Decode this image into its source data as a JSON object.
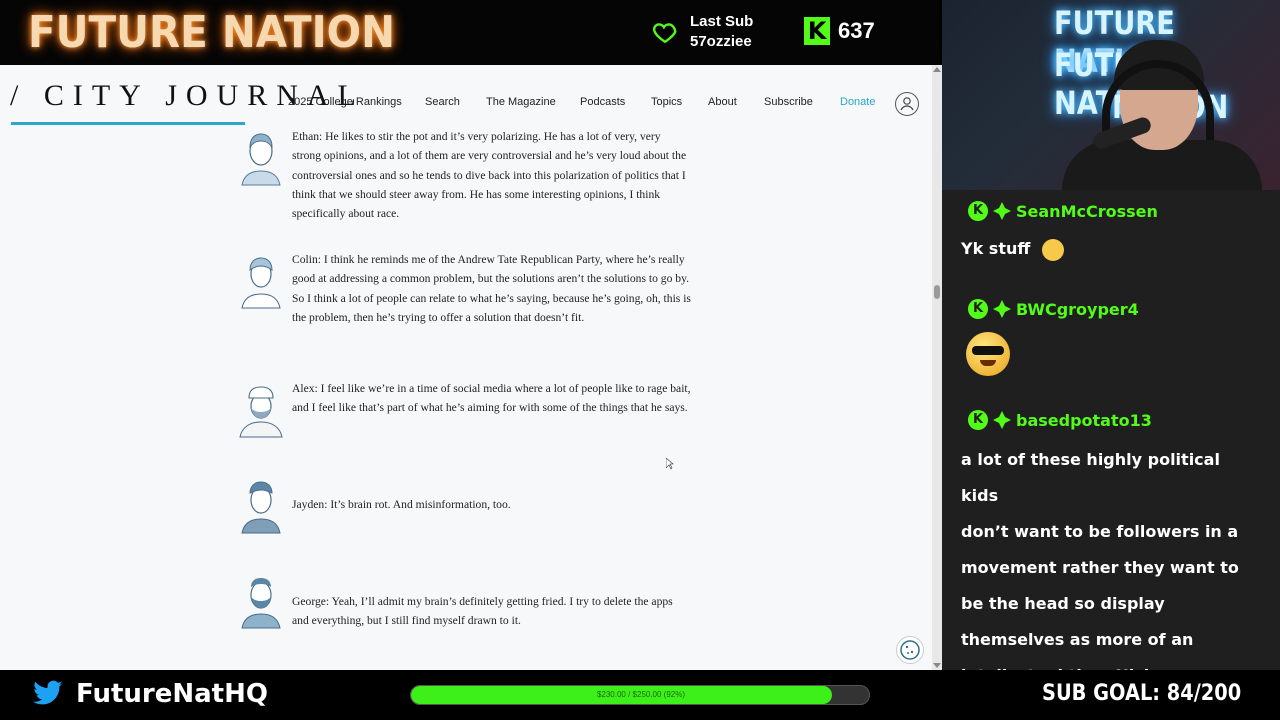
{
  "overlay": {
    "brand": "FUTURE NATION",
    "last_sub_label": "Last Sub",
    "last_sub_name": "57ozziee",
    "kick_badge": "K",
    "follower_count": "637",
    "accent_color": "#53fc18"
  },
  "site": {
    "logo": "/ CITY JOURNAL",
    "nav": [
      "2025 College Rankings",
      "Search",
      "The Magazine",
      "Podcasts",
      "Topics",
      "About",
      "Subscribe",
      "Donate"
    ],
    "donate_color": "#2aa7c9"
  },
  "article": {
    "entries": [
      {
        "avatar": "ethan-avatar",
        "text": "Ethan: He likes to stir the pot and it’s very polarizing. He has a lot of very, very strong opinions, and a lot of them are very controversial and he’s very loud about the controversial ones and so he tends to dive back into this polarization of politics that I think that we should steer away from. He has some interesting opinions, I think specifically about race."
      },
      {
        "avatar": "colin-avatar",
        "text": "Colin: I think he reminds me of the Andrew Tate Republican Party, where he’s really good at addressing a common problem, but the solutions aren’t the solutions to go by. So I think a lot of people can relate to what he’s saying, because he’s going, oh, this is the problem, then he’s trying to offer a solution that doesn’t fit."
      },
      {
        "avatar": "alex-avatar",
        "text": "Alex: I feel like we’re in a time of social media where a lot of people like to rage bait, and I feel like that’s part of what he’s aiming for with some of the things that he says."
      },
      {
        "avatar": "jayden-avatar",
        "text": "Jayden: It’s brain rot. And misinformation, too."
      },
      {
        "avatar": "george-avatar",
        "text": "George: Yeah, I’ll admit my brain’s definitely getting fried. I try to delete the apps and everything, but I still find myself drawn to it."
      }
    ]
  },
  "webcam": {
    "sign_lines": [
      "FUTURE NATION",
      "FUTURE NATION",
      "NATION"
    ]
  },
  "chat": {
    "messages": [
      {
        "user": "SeanMcCrossen",
        "text": "Yk stuff"
      },
      {
        "user": "BWCgroyper4",
        "text": ""
      },
      {
        "user": "basedpotato13",
        "lines": [
          "a lot of these highly political kids",
          "don’t want to be followers in a",
          "movement rather they want to",
          "be the head so display",
          "themselves as more of an",
          "intellectual than Nick"
        ]
      }
    ]
  },
  "footer": {
    "twitter_handle": "FutureNatHQ",
    "donation_goal_text": "$230.00 / $250.00 (92%)",
    "donation_progress": 0.92,
    "sub_goal": "SUB GOAL: 84/200"
  }
}
